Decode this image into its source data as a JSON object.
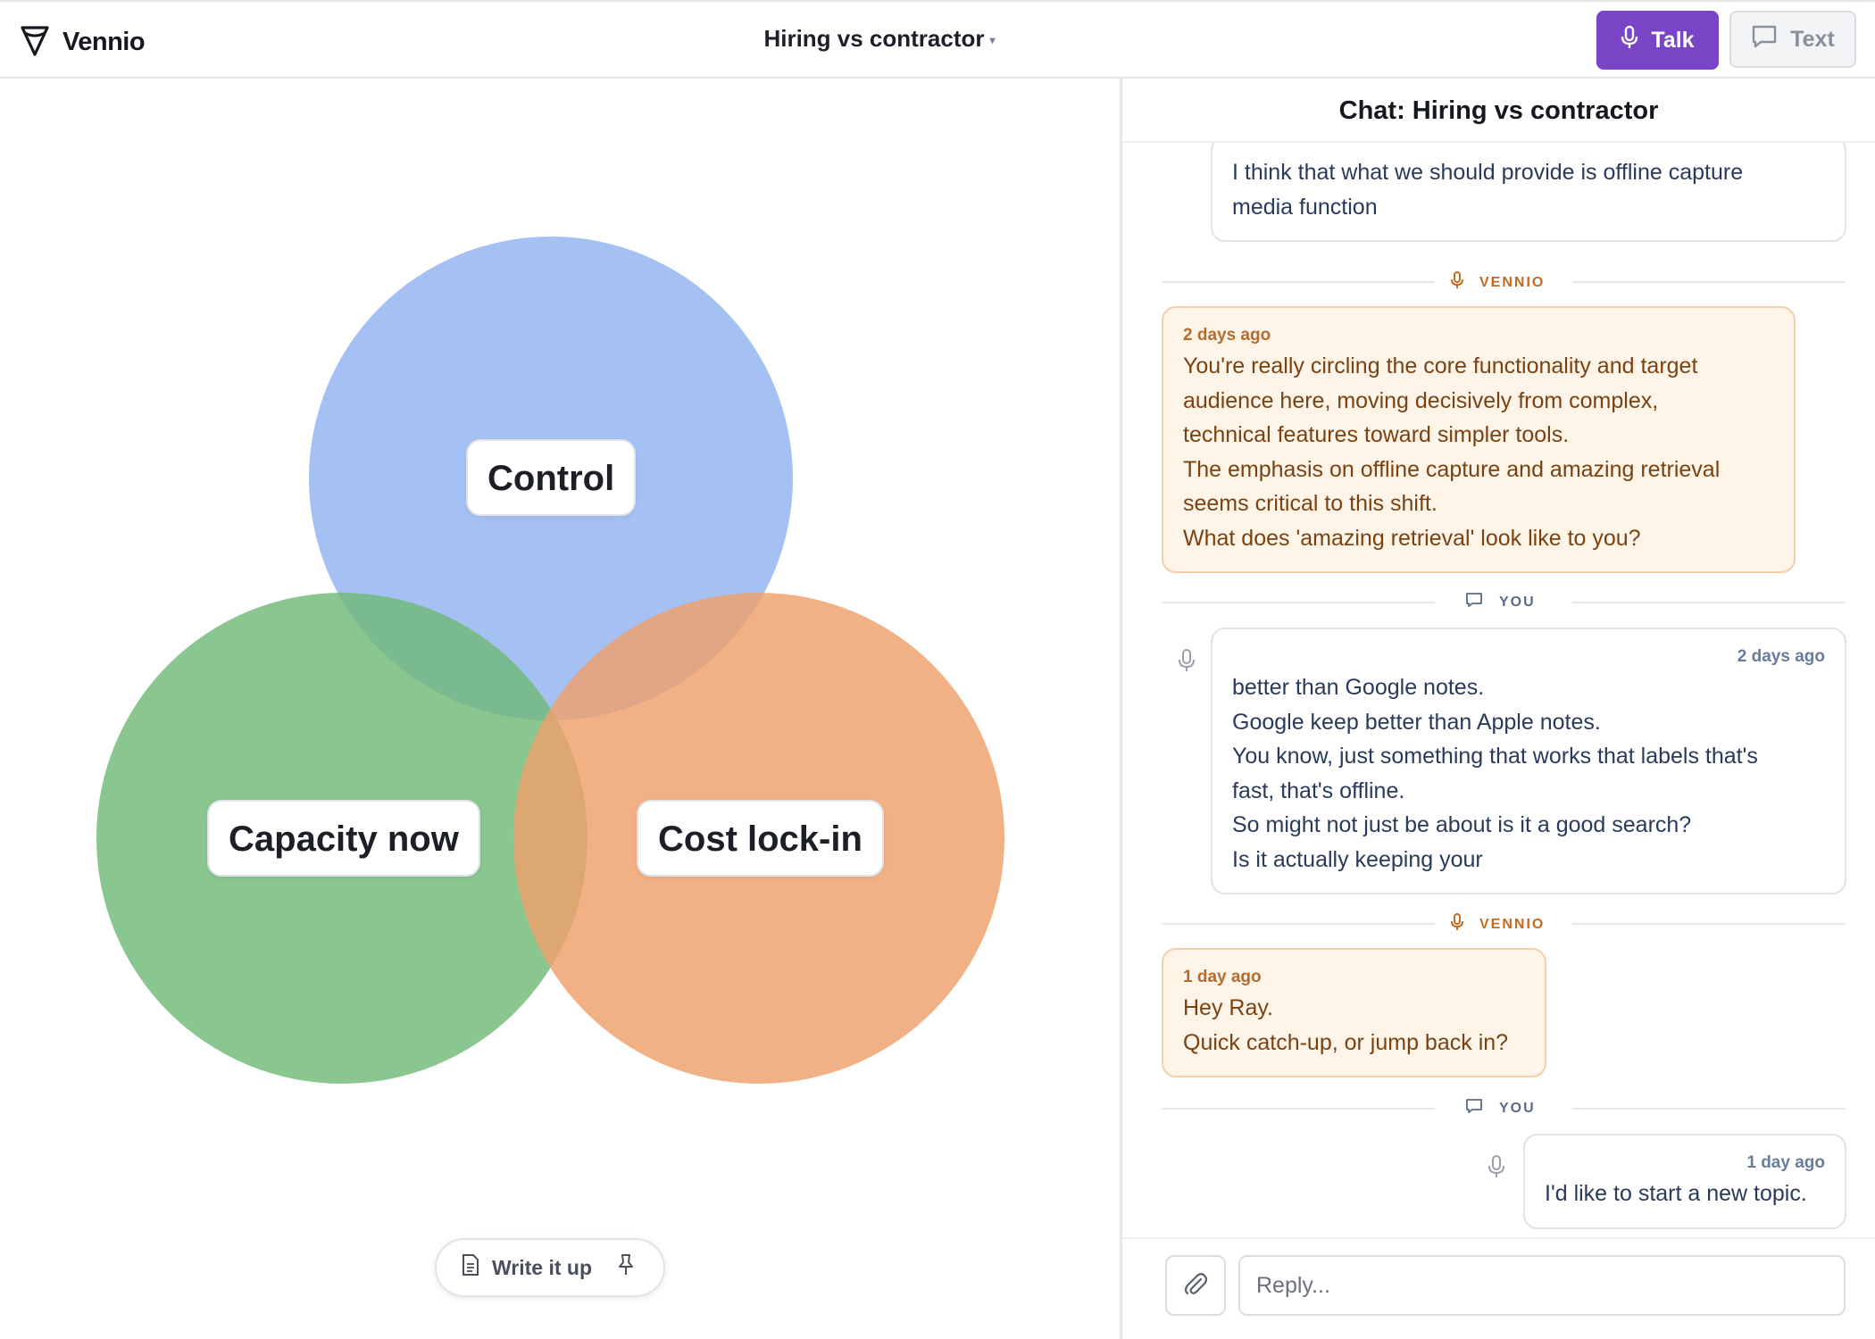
{
  "app": {
    "name": "Vennio"
  },
  "header": {
    "doc_title": "Hiring vs contractor",
    "talk_label": "Talk",
    "text_label": "Text"
  },
  "venn": {
    "sets": [
      {
        "label": "Control",
        "color": "#8fb0ef"
      },
      {
        "label": "Capacity now",
        "color": "#6fba78"
      },
      {
        "label": "Cost lock-in",
        "color": "#eea06a"
      }
    ]
  },
  "canvas": {
    "write_up_label": "Write it up"
  },
  "chat": {
    "title": "Chat: Hiring vs contractor",
    "role_ai": "VENNIO",
    "role_you": "YOU",
    "messages": [
      {
        "role": "you",
        "timestamp": "",
        "lines": [
          "I think that what we should provide is offline capture",
          "media function"
        ]
      },
      {
        "role": "ai",
        "timestamp": "2 days ago",
        "lines": [
          "You're really circling the core functionality and target",
          "audience here, moving decisively from complex,",
          "technical features toward simpler tools.",
          "The emphasis on offline capture and amazing retrieval",
          "seems critical to this shift.",
          "What does 'amazing retrieval' look like to you?"
        ]
      },
      {
        "role": "you",
        "timestamp": "2 days ago",
        "lines": [
          "better than Google notes.",
          "Google keep better than Apple notes.",
          "You know, just something that works that labels that's",
          "fast, that's offline.",
          "So might not just be about is it a good search?",
          "Is it actually keeping your"
        ]
      },
      {
        "role": "ai",
        "timestamp": "1 day ago",
        "lines": [
          "Hey Ray.",
          "Quick catch-up, or jump back in?"
        ]
      },
      {
        "role": "you",
        "timestamp": "1 day ago",
        "lines": [
          "I'd like to start a new topic."
        ]
      }
    ],
    "reply_placeholder": "Reply..."
  }
}
